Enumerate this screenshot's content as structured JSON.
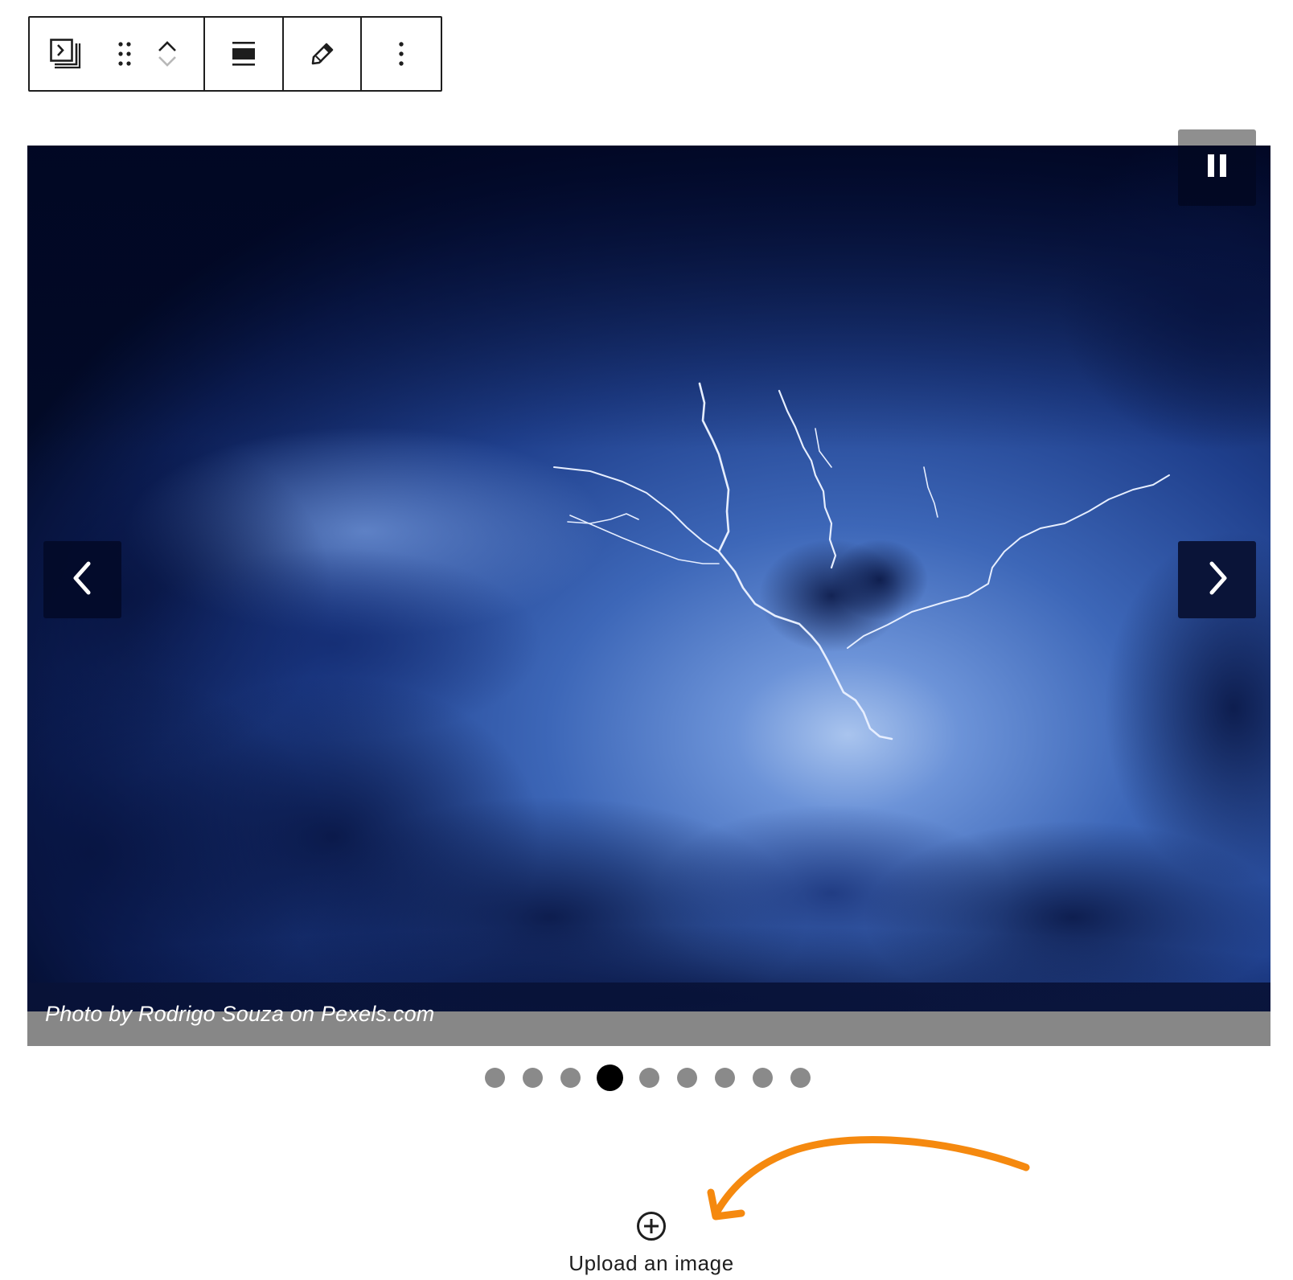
{
  "toolbar": {
    "buttons": [
      {
        "name": "slider-block-icon"
      },
      {
        "name": "drag-handle-icon"
      },
      {
        "name": "move-up-icon"
      },
      {
        "name": "move-down-icon"
      },
      {
        "name": "align-icon"
      },
      {
        "name": "edit-pencil-icon"
      },
      {
        "name": "more-options-icon"
      }
    ]
  },
  "slider": {
    "caption": "Photo by Rodrigo Souza on Pexels.com",
    "total_slides": 9,
    "active_slide": 4,
    "controls": {
      "pause_icon": "pause-icon",
      "prev_icon": "chevron-left-icon",
      "next_icon": "chevron-right-icon"
    }
  },
  "upload": {
    "label": "Upload an image",
    "icon": "plus-circle-icon"
  },
  "annotation": {
    "arrow_color": "#f5890f"
  }
}
